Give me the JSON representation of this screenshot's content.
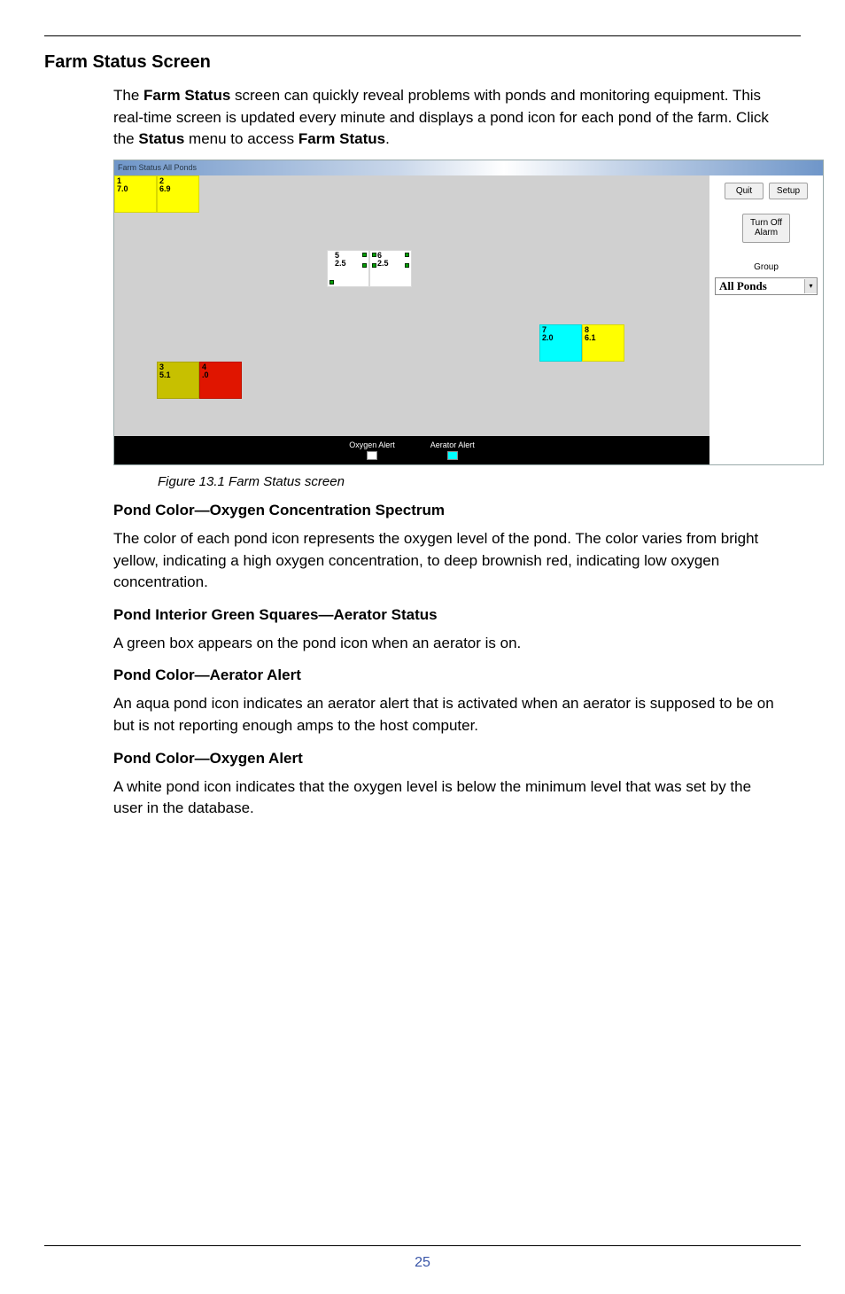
{
  "header": {
    "title": "Farm Status Screen"
  },
  "intro": {
    "lead1": "The ",
    "bold1": "Farm Status",
    "mid1": " screen can quickly reveal problems with ponds and monitoring equipment. This real-time screen is updated every minute and displays a pond icon for each pond of the farm. Click the ",
    "bold2": "Status",
    "mid2": " menu to access ",
    "bold3": "Farm Status",
    "tail": "."
  },
  "screenshot": {
    "window_title": "Farm Status All Ponds",
    "ponds": {
      "p1": {
        "id": "1",
        "val": "7.0"
      },
      "p2": {
        "id": "2",
        "val": "6.9"
      },
      "p3": {
        "id": "3",
        "val": "5.1"
      },
      "p4": {
        "id": "4",
        "val": ".0"
      },
      "p5": {
        "id": "5",
        "val": "2.5"
      },
      "p6": {
        "id": "6",
        "val": "2.5"
      },
      "p7": {
        "id": "7",
        "val": "2.0"
      },
      "p8": {
        "id": "8",
        "val": "6.1"
      }
    },
    "legend": {
      "oxygen": "Oxygen Alert",
      "aerator": "Aerator Alert"
    },
    "side": {
      "quit": "Quit",
      "setup": "Setup",
      "turn_off": "Turn Off\nAlarm",
      "group_label": "Group",
      "group_selected": "All Ponds"
    }
  },
  "caption": "Figure 13.1 Farm Status screen",
  "section1": {
    "heading": "Pond Color—Oxygen Concentration Spectrum",
    "body": "The color of each pond icon represents the oxygen level of the pond. The color varies from bright yellow, indicating a high oxygen concentration, to deep brownish red, indicating low oxygen concentration."
  },
  "section2": {
    "heading": "Pond Interior Green Squares—Aerator Status",
    "body": "A green box appears on the pond icon when an aerator is on."
  },
  "section3": {
    "heading": "Pond Color—Aerator Alert",
    "body": "An aqua pond icon indicates an aerator alert that is activated when an aerator is supposed to be on but is not reporting enough amps to the host computer."
  },
  "section4": {
    "heading": "Pond Color—Oxygen Alert",
    "body": "A white pond icon indicates that the oxygen level is below the minimum level that was set by the user in the database."
  },
  "page_number": "25"
}
